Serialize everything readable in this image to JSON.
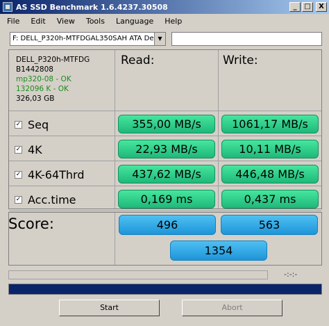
{
  "window": {
    "title": "AS SSD Benchmark 1.6.4237.30508",
    "buttons": [
      "_",
      "□",
      "X"
    ]
  },
  "menu": [
    "File",
    "Edit",
    "View",
    "Tools",
    "Language",
    "Help"
  ],
  "drive_select": {
    "value": "F: DELL_P320h-MTFDGAL350SAH ATA Dev",
    "arrow": "▼"
  },
  "drive_info": {
    "model": "DELL_P320h-MTFDG",
    "firmware": "B1442808",
    "driver_status": "mp320-08 - OK",
    "alignment_status": "132096 K - OK",
    "size": "326,03 GB"
  },
  "columns": {
    "read": "Read:",
    "write": "Write:"
  },
  "tests": [
    {
      "name": "Seq",
      "checked": "✓",
      "read": "355,00 MB/s",
      "write": "1061,17 MB/s"
    },
    {
      "name": "4K",
      "checked": "✓",
      "read": "22,93 MB/s",
      "write": "10,11 MB/s"
    },
    {
      "name": "4K-64Thrd",
      "checked": "✓",
      "read": "437,62 MB/s",
      "write": "446,48 MB/s"
    },
    {
      "name": "Acc.time",
      "checked": "✓",
      "read": "0,169 ms",
      "write": "0,437 ms"
    }
  ],
  "score": {
    "label": "Score:",
    "read": "496",
    "write": "563",
    "total": "1354"
  },
  "status": {
    "time": "-:-:-",
    "progress": 1.0
  },
  "buttons": {
    "start": "Start",
    "abort": "Abort"
  },
  "colors": {
    "result_green": "#2ed08a",
    "score_blue": "#2aa8e6",
    "titlebar": "#0a246a"
  }
}
